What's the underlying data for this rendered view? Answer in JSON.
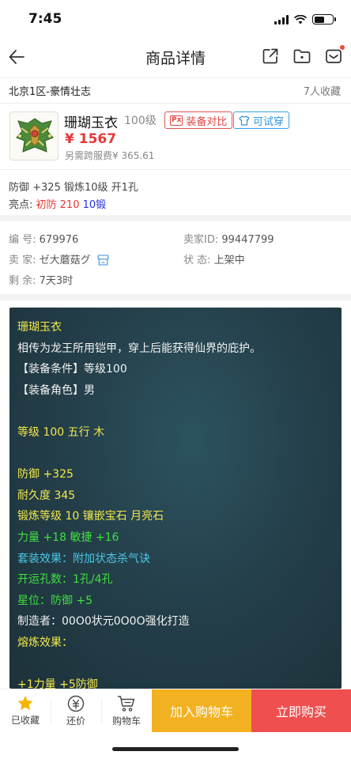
{
  "status_bar": {
    "time": "7:45"
  },
  "nav": {
    "title": "商品详情"
  },
  "server": {
    "name": "北京1区-豪情壮志",
    "favorites": "7人收藏"
  },
  "item": {
    "name": "珊瑚玉衣",
    "level": "100级",
    "compare_label": "装备对比",
    "compare_badge": "Px",
    "tryon_label": "可试穿",
    "price": "¥ 1567",
    "cross_fee": "另需跨服费¥ 365.61",
    "attributes": "防御 +325 锻炼10级 开1孔",
    "highlight_prefix": "亮点:",
    "highlight_red": "初防 210",
    "highlight_blue": "10锻"
  },
  "meta": {
    "id_label": "编 号:",
    "id_value": "679976",
    "seller_id_label": "卖家ID:",
    "seller_id_value": "99447799",
    "seller_label": "卖 家:",
    "seller_value": "ゼ大蘑菇グ",
    "status_label": "状 态:",
    "status_value": "上架中",
    "remaining_label": "剩 余:",
    "remaining_value": "7天3时"
  },
  "description": [
    {
      "text": "珊瑚玉衣",
      "color": "yellow"
    },
    {
      "text": "相传为龙王所用铠甲，穿上后能获得仙界的庇护。",
      "color": "white"
    },
    {
      "text": "【装备条件】等级100",
      "color": "white"
    },
    {
      "text": "【装备角色】男",
      "color": "white"
    },
    {
      "text": "",
      "color": "white"
    },
    {
      "text": "等级 100 五行 木",
      "color": "yellow"
    },
    {
      "text": "",
      "color": "white"
    },
    {
      "text": "防御 +325",
      "color": "yellow"
    },
    {
      "text": "耐久度 345",
      "color": "yellow"
    },
    {
      "text": "锻炼等级 10 镶嵌宝石 月亮石",
      "color": "yellow"
    },
    {
      "text": "力量 +18 敏捷 +16",
      "color": "green"
    },
    {
      "text": "套装效果：附加状态杀气诀",
      "color": "cyan"
    },
    {
      "text": "开运孔数：1孔/4孔",
      "color": "green"
    },
    {
      "text": "星位：防御 +5",
      "color": "green"
    },
    {
      "text": "制造者：00O0状元0O0O强化打造",
      "color": "white"
    },
    {
      "text": "熔炼效果：",
      "color": "yellow"
    },
    {
      "text": "",
      "color": "white"
    },
    {
      "text": "+1力量 +5防御",
      "color": "yellow"
    }
  ],
  "bottom_bar": {
    "favorited": "已收藏",
    "bargain": "还价",
    "cart": "购物车",
    "add_to_cart": "加入购物车",
    "buy_now": "立即购买"
  },
  "colors": {
    "price_red": "#e53935",
    "cart_button": "#f2b120",
    "buy_button": "#ef4f4f",
    "tryon_blue": "#2f96e0",
    "highlight_blue": "#2233d6",
    "desc_yellow": "#f3e84a",
    "desc_green": "#3fe03f",
    "desc_cyan": "#4bc7e8"
  }
}
